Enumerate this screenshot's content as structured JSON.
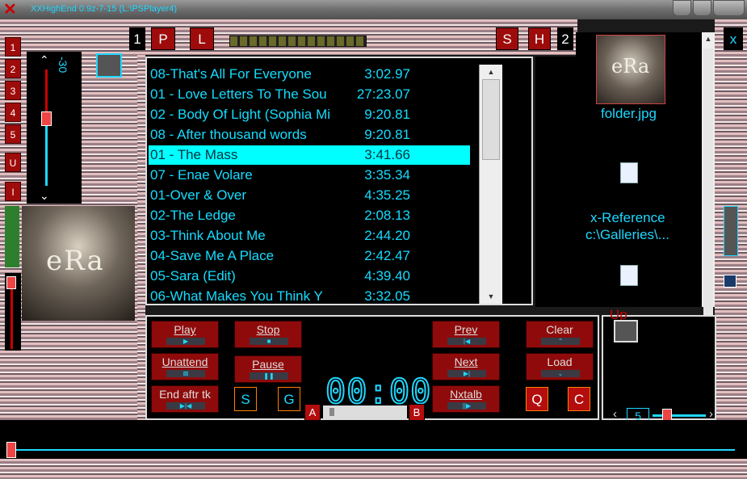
{
  "window": {
    "title": "XXHighEnd 0.9z-7-15 (L:\\PSPlayer4)"
  },
  "colors": {
    "accent": "#1fd7ff",
    "button": "#9e0b0b",
    "selection": "#00ffff"
  },
  "top_buttons": {
    "b1": "1",
    "p": "P",
    "l": "L",
    "s": "S",
    "h": "H",
    "b2": "2",
    "x": "x"
  },
  "left_buttons": [
    "1",
    "2",
    "3",
    "4",
    "5",
    "U",
    "I"
  ],
  "volume": {
    "label": "-30"
  },
  "playlist": {
    "tracks": [
      {
        "name": "08-That's All For Everyone",
        "duration": "3:02.97"
      },
      {
        "name": "01 - Love Letters To The Sou",
        "duration": "27:23.07"
      },
      {
        "name": "02 - Body Of Light (Sophia Mi",
        "duration": "9:20.81"
      },
      {
        "name": "08 - After thousand words",
        "duration": "9:20.81"
      },
      {
        "name": "01 - The Mass",
        "duration": "3:41.66"
      },
      {
        "name": "07 - Enae Volare",
        "duration": "3:35.34"
      },
      {
        "name": "01-Over & Over",
        "duration": "4:35.25"
      },
      {
        "name": "02-The Ledge",
        "duration": "2:08.13"
      },
      {
        "name": "03-Think About Me",
        "duration": "2:44.20"
      },
      {
        "name": "04-Save Me A Place",
        "duration": "2:42.47"
      },
      {
        "name": "05-Sara (Edit)",
        "duration": "4:39.40"
      },
      {
        "name": "06-What Makes You Think Y",
        "duration": "3:32.05"
      }
    ],
    "selected_index": 4
  },
  "files": {
    "folder_label": "folder.jpg",
    "xref_line1": "x-Reference",
    "xref_line2": "c:\\Galleries\\..."
  },
  "transport": {
    "play": "Play",
    "stop": "Stop",
    "prev": "Prev",
    "clear": "Clear",
    "unattend": "Unattend",
    "pause": "Pause",
    "next": "Next",
    "load": "Load",
    "end_after": "End aftr tk",
    "s": "S",
    "g": "G",
    "nxtalb": "Nxtalb",
    "q": "Q",
    "c": "C",
    "timer": "00:00",
    "a": "A",
    "b": "B"
  },
  "up_panel": {
    "up_label": "Up",
    "value": "5"
  }
}
